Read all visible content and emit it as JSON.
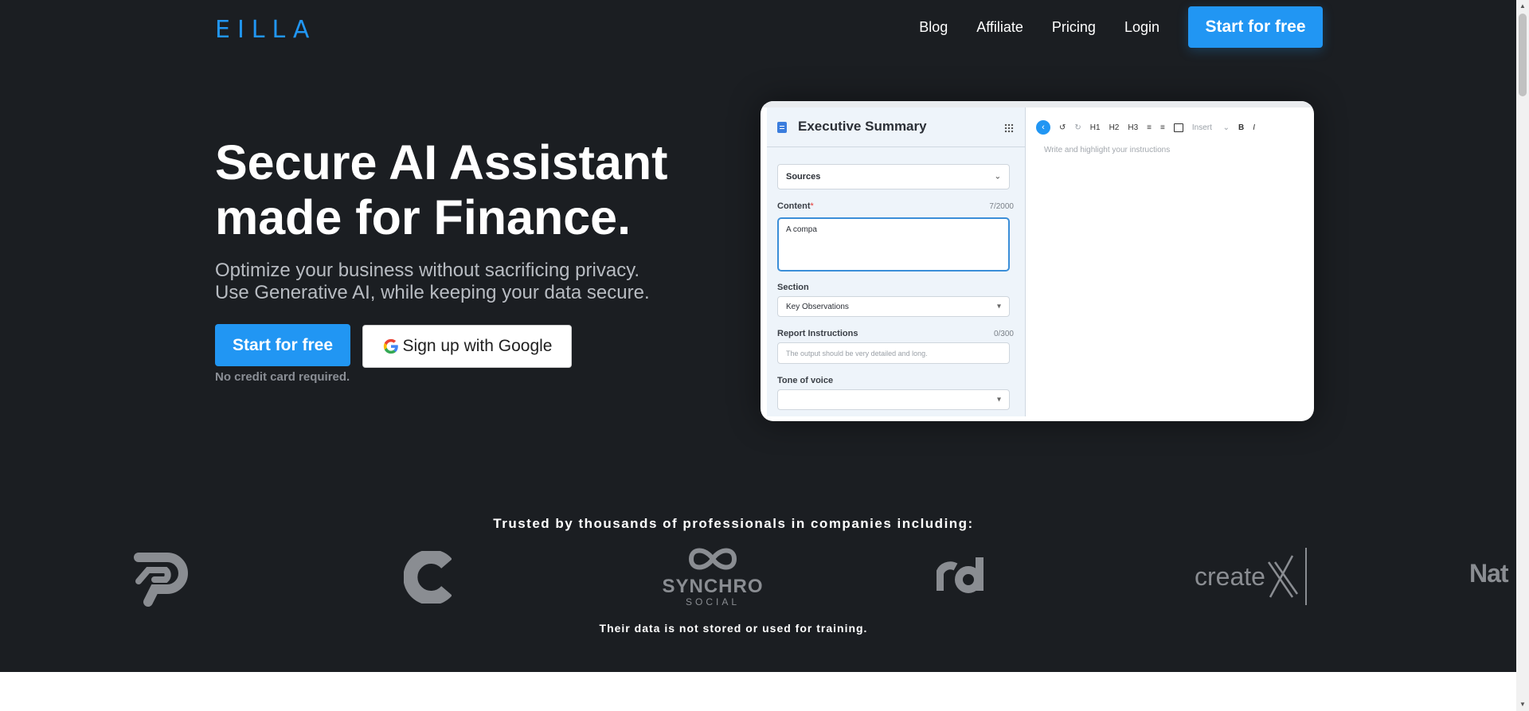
{
  "header": {
    "logo": "EILLA",
    "nav": [
      "Blog",
      "Affiliate",
      "Pricing",
      "Login"
    ],
    "cta": "Start for free"
  },
  "hero": {
    "headline_line1": "Secure AI Assistant",
    "headline_line2": "made for Finance.",
    "subhead_line1": "Optimize your business without sacrificing privacy.",
    "subhead_line2": "Use Generative AI, while keeping your data secure.",
    "primary_button": "Start for free",
    "google_button": "Sign up with Google",
    "note": "No credit card required."
  },
  "preview": {
    "title": "Executive Summary",
    "sources_label": "Sources",
    "content_label": "Content",
    "content_required": "*",
    "content_count": "7/2000",
    "content_value": "A compa",
    "section_label": "Section",
    "section_value": "Key Observations",
    "report_label": "Report Instructions",
    "report_count": "0/300",
    "report_placeholder": "The output should be very detailed and long.",
    "tone_label": "Tone of voice",
    "toolbar": [
      "H1",
      "H2",
      "H3",
      "Insert",
      "B",
      "I"
    ],
    "editor_placeholder": "Write and highlight your instructions"
  },
  "trusted": {
    "heading": "Trusted by thousands of professionals in companies including:",
    "logos": [
      "synchro-social",
      "createx",
      "nat"
    ],
    "logo_text": {
      "synchro_line1": "SYNCHRO",
      "synchro_line2": "SOCIAL",
      "createx": "create",
      "nat": "Nat"
    },
    "disclaimer": "Their data is not stored or used for training."
  },
  "colors": {
    "accent": "#2196f3",
    "hero_bg": "#1b1e22",
    "logo_grey": "#8a8d92"
  }
}
